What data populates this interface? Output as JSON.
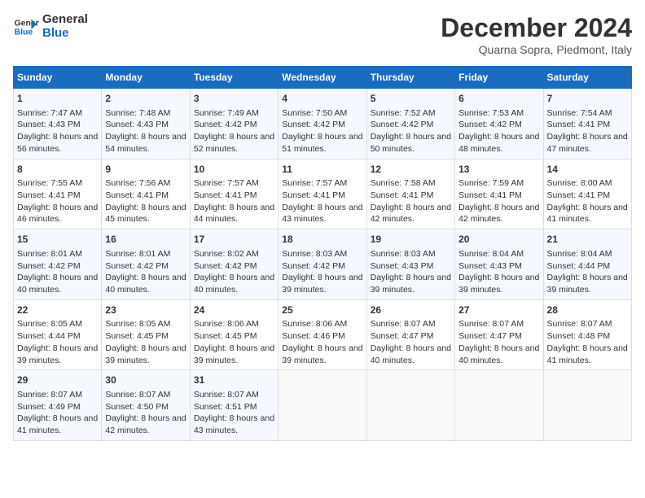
{
  "logo": {
    "line1": "General",
    "line2": "Blue"
  },
  "title": "December 2024",
  "location": "Quarna Sopra, Piedmont, Italy",
  "days_of_week": [
    "Sunday",
    "Monday",
    "Tuesday",
    "Wednesday",
    "Thursday",
    "Friday",
    "Saturday"
  ],
  "weeks": [
    [
      {
        "day": "1",
        "sunrise": "7:47 AM",
        "sunset": "4:43 PM",
        "daylight": "8 hours and 56 minutes."
      },
      {
        "day": "2",
        "sunrise": "7:48 AM",
        "sunset": "4:43 PM",
        "daylight": "8 hours and 54 minutes."
      },
      {
        "day": "3",
        "sunrise": "7:49 AM",
        "sunset": "4:42 PM",
        "daylight": "8 hours and 52 minutes."
      },
      {
        "day": "4",
        "sunrise": "7:50 AM",
        "sunset": "4:42 PM",
        "daylight": "8 hours and 51 minutes."
      },
      {
        "day": "5",
        "sunrise": "7:52 AM",
        "sunset": "4:42 PM",
        "daylight": "8 hours and 50 minutes."
      },
      {
        "day": "6",
        "sunrise": "7:53 AM",
        "sunset": "4:42 PM",
        "daylight": "8 hours and 48 minutes."
      },
      {
        "day": "7",
        "sunrise": "7:54 AM",
        "sunset": "4:41 PM",
        "daylight": "8 hours and 47 minutes."
      }
    ],
    [
      {
        "day": "8",
        "sunrise": "7:55 AM",
        "sunset": "4:41 PM",
        "daylight": "8 hours and 46 minutes."
      },
      {
        "day": "9",
        "sunrise": "7:56 AM",
        "sunset": "4:41 PM",
        "daylight": "8 hours and 45 minutes."
      },
      {
        "day": "10",
        "sunrise": "7:57 AM",
        "sunset": "4:41 PM",
        "daylight": "8 hours and 44 minutes."
      },
      {
        "day": "11",
        "sunrise": "7:57 AM",
        "sunset": "4:41 PM",
        "daylight": "8 hours and 43 minutes."
      },
      {
        "day": "12",
        "sunrise": "7:58 AM",
        "sunset": "4:41 PM",
        "daylight": "8 hours and 42 minutes."
      },
      {
        "day": "13",
        "sunrise": "7:59 AM",
        "sunset": "4:41 PM",
        "daylight": "8 hours and 42 minutes."
      },
      {
        "day": "14",
        "sunrise": "8:00 AM",
        "sunset": "4:41 PM",
        "daylight": "8 hours and 41 minutes."
      }
    ],
    [
      {
        "day": "15",
        "sunrise": "8:01 AM",
        "sunset": "4:42 PM",
        "daylight": "8 hours and 40 minutes."
      },
      {
        "day": "16",
        "sunrise": "8:01 AM",
        "sunset": "4:42 PM",
        "daylight": "8 hours and 40 minutes."
      },
      {
        "day": "17",
        "sunrise": "8:02 AM",
        "sunset": "4:42 PM",
        "daylight": "8 hours and 40 minutes."
      },
      {
        "day": "18",
        "sunrise": "8:03 AM",
        "sunset": "4:42 PM",
        "daylight": "8 hours and 39 minutes."
      },
      {
        "day": "19",
        "sunrise": "8:03 AM",
        "sunset": "4:43 PM",
        "daylight": "8 hours and 39 minutes."
      },
      {
        "day": "20",
        "sunrise": "8:04 AM",
        "sunset": "4:43 PM",
        "daylight": "8 hours and 39 minutes."
      },
      {
        "day": "21",
        "sunrise": "8:04 AM",
        "sunset": "4:44 PM",
        "daylight": "8 hours and 39 minutes."
      }
    ],
    [
      {
        "day": "22",
        "sunrise": "8:05 AM",
        "sunset": "4:44 PM",
        "daylight": "8 hours and 39 minutes."
      },
      {
        "day": "23",
        "sunrise": "8:05 AM",
        "sunset": "4:45 PM",
        "daylight": "8 hours and 39 minutes."
      },
      {
        "day": "24",
        "sunrise": "8:06 AM",
        "sunset": "4:45 PM",
        "daylight": "8 hours and 39 minutes."
      },
      {
        "day": "25",
        "sunrise": "8:06 AM",
        "sunset": "4:46 PM",
        "daylight": "8 hours and 39 minutes."
      },
      {
        "day": "26",
        "sunrise": "8:07 AM",
        "sunset": "4:47 PM",
        "daylight": "8 hours and 40 minutes."
      },
      {
        "day": "27",
        "sunrise": "8:07 AM",
        "sunset": "4:47 PM",
        "daylight": "8 hours and 40 minutes."
      },
      {
        "day": "28",
        "sunrise": "8:07 AM",
        "sunset": "4:48 PM",
        "daylight": "8 hours and 41 minutes."
      }
    ],
    [
      {
        "day": "29",
        "sunrise": "8:07 AM",
        "sunset": "4:49 PM",
        "daylight": "8 hours and 41 minutes."
      },
      {
        "day": "30",
        "sunrise": "8:07 AM",
        "sunset": "4:50 PM",
        "daylight": "8 hours and 42 minutes."
      },
      {
        "day": "31",
        "sunrise": "8:07 AM",
        "sunset": "4:51 PM",
        "daylight": "8 hours and 43 minutes."
      },
      null,
      null,
      null,
      null
    ]
  ],
  "labels": {
    "sunrise": "Sunrise:",
    "sunset": "Sunset:",
    "daylight": "Daylight:"
  }
}
